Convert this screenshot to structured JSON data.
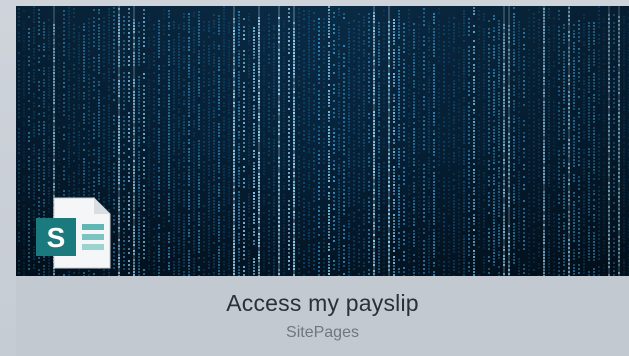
{
  "card": {
    "title": "Access my payslip",
    "subtitle": "SitePages",
    "thumbnail": "digital-rain-matrix-banner",
    "file_icon": "sharepoint-page-icon",
    "file_icon_letter": "S"
  },
  "colors": {
    "page_background": "#c9ced6",
    "card_background": "#c3c9d1",
    "title_text": "#2b2f36",
    "subtitle_text": "#707680",
    "banner_dark": "#04121f",
    "banner_glow": "#3aa3e0",
    "icon_teal": "#1b7a7d"
  }
}
